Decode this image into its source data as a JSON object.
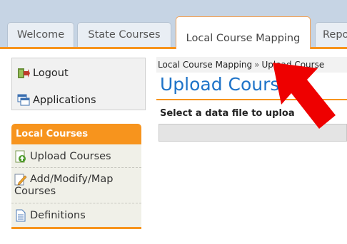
{
  "tabs": [
    {
      "label": "Welcome",
      "active": false
    },
    {
      "label": "State Courses",
      "active": false
    },
    {
      "label": "Local Course Mapping",
      "active": true
    },
    {
      "label": "Repo",
      "active": false
    }
  ],
  "sidebar": {
    "top_items": [
      {
        "label": "Logout",
        "icon": "logout-icon"
      },
      {
        "label": "Applications",
        "icon": "applications-icon"
      }
    ],
    "section_title": "Local Courses",
    "items": [
      {
        "label": "Upload Courses",
        "icon": "upload-icon"
      },
      {
        "label": "Add/Modify/Map",
        "label2": "Courses",
        "icon": "edit-icon"
      },
      {
        "label": "Definitions",
        "icon": "document-icon"
      }
    ]
  },
  "breadcrumb": {
    "parent": "Local Course Mapping",
    "separator": "»",
    "current": "Upload Course"
  },
  "main": {
    "title": "Upload Courses",
    "file_label": "Select a data file to uploa"
  },
  "colors": {
    "accent_orange": "#f7941d",
    "title_blue": "#1e73c8",
    "annotation_red": "#ee0000"
  }
}
